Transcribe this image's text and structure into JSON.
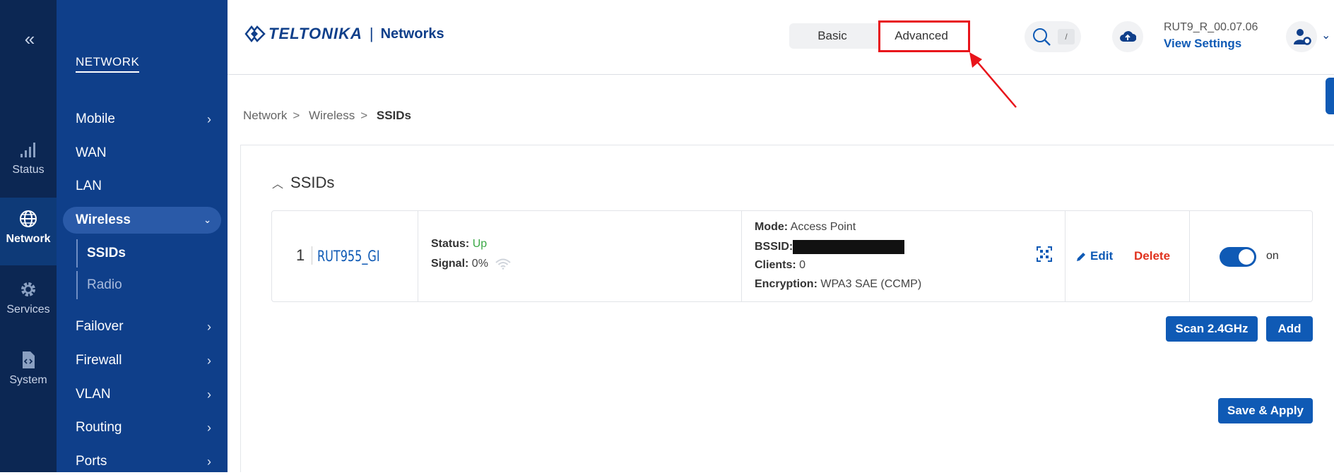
{
  "rail": {
    "collapse_label": "«",
    "items": [
      {
        "label": "Status",
        "icon": "signal-icon"
      },
      {
        "label": "Network",
        "icon": "globe-icon"
      },
      {
        "label": "Services",
        "icon": "gear-icon"
      },
      {
        "label": "System",
        "icon": "file-code-icon"
      }
    ]
  },
  "sidebar": {
    "title": "NETWORK",
    "items": [
      {
        "label": "Mobile",
        "has_children": true
      },
      {
        "label": "WAN",
        "has_children": false
      },
      {
        "label": "LAN",
        "has_children": false
      },
      {
        "label": "Wireless",
        "expanded": true
      },
      {
        "label": "Failover",
        "has_children": true
      },
      {
        "label": "Firewall",
        "has_children": true
      },
      {
        "label": "VLAN",
        "has_children": true
      },
      {
        "label": "Routing",
        "has_children": true
      },
      {
        "label": "Ports",
        "has_children": true
      }
    ],
    "wireless_sub": [
      {
        "label": "SSIDs",
        "active": true
      },
      {
        "label": "Radio",
        "active": false
      }
    ]
  },
  "header": {
    "logo_brand": "TELTONIKA",
    "logo_divider": "|",
    "logo_sub": "Networks",
    "mode_basic": "Basic",
    "mode_advanced": "Advanced",
    "search_shortcut": "/",
    "firmware_version": "RUT9_R_00.07.06",
    "view_settings": "View Settings"
  },
  "breadcrumb": {
    "items": [
      "Network",
      "Wireless",
      "SSIDs"
    ],
    "separator": ">"
  },
  "ssids": {
    "section_title": "SSIDs",
    "rows": [
      {
        "index": "1",
        "name": "RUT955_GI",
        "status_label": "Status:",
        "status_value": "Up",
        "signal_label": "Signal:",
        "signal_value": "0%",
        "mode_label": "Mode:",
        "mode_value": "Access Point",
        "bssid_label": "BSSID:",
        "clients_label": "Clients:",
        "clients_value": "0",
        "encryption_label": "Encryption:",
        "encryption_value": "WPA3 SAE (CCMP)",
        "edit_label": "Edit",
        "delete_label": "Delete",
        "enabled": true,
        "toggle_label": "on"
      }
    ],
    "scan_button": "Scan 2.4GHz",
    "add_button": "Add",
    "save_button": "Save & Apply"
  },
  "colors": {
    "rail_bg": "#0c2753",
    "sidebar_bg": "#0f3f8a",
    "accent": "#0f5ab5",
    "status_up": "#3aa845",
    "delete": "#e0321e",
    "annotation": "#e8141b"
  }
}
